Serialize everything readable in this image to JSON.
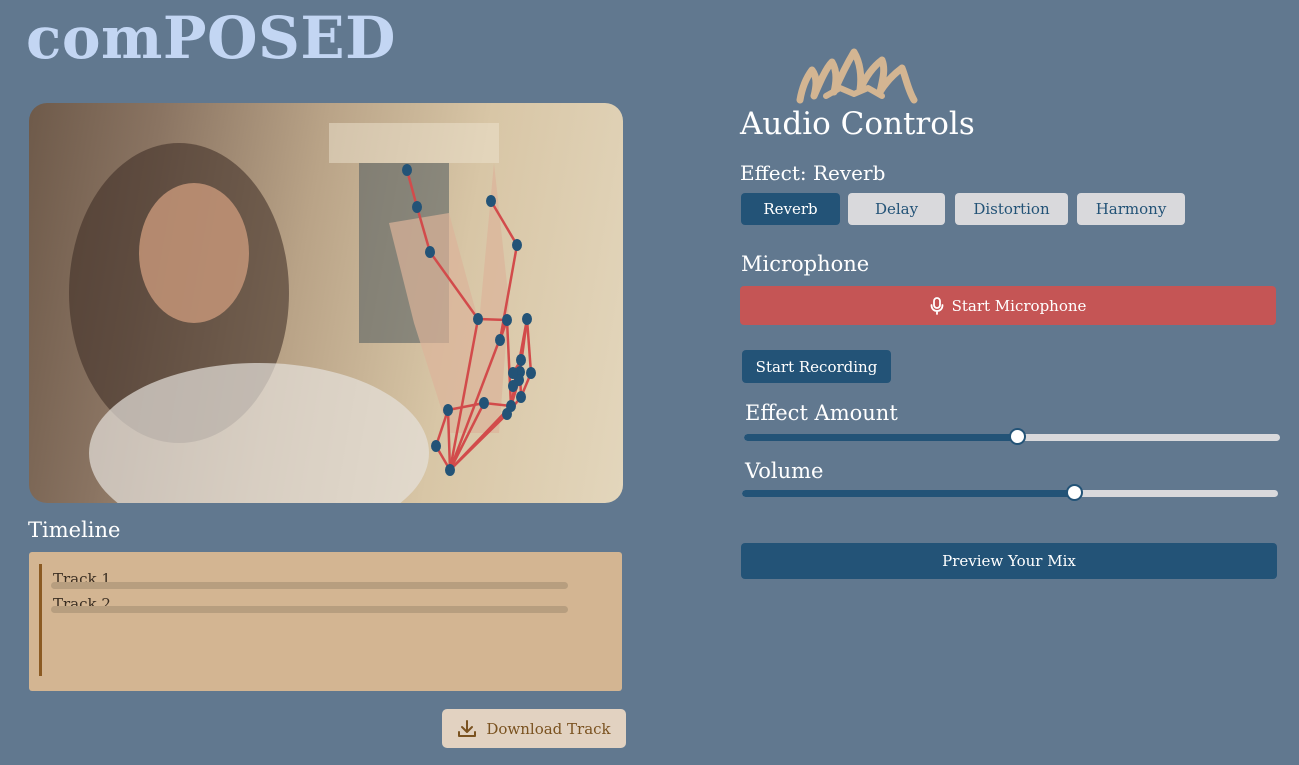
{
  "app": {
    "title": "comPOSED"
  },
  "timeline": {
    "title": "Timeline",
    "tracks": [
      {
        "label": "Track 1"
      },
      {
        "label": "Track 2"
      }
    ],
    "download_label": "Download Track",
    "download_icon": "download-icon"
  },
  "audio_controls": {
    "title": "Audio Controls",
    "effect_label": "Effect: Reverb",
    "effects": [
      {
        "label": "Reverb",
        "active": true
      },
      {
        "label": "Delay",
        "active": false
      },
      {
        "label": "Distortion",
        "active": false
      },
      {
        "label": "Harmony",
        "active": false
      }
    ],
    "microphone": {
      "title": "Microphone",
      "start_label": "Start Microphone",
      "icon": "microphone-icon"
    },
    "recording_label": "Start Recording",
    "effect_amount": {
      "label": "Effect Amount",
      "value": 0.51
    },
    "volume": {
      "label": "Volume",
      "value": 0.62
    },
    "preview_label": "Preview Your Mix"
  },
  "colors": {
    "background": "#61788f",
    "logo": "#c3d6f3",
    "primary": "#235377",
    "mic_button": "#c55555",
    "timeline_bg": "#d3b592",
    "crown": "#d3b592",
    "hand_landmark": "#235377",
    "hand_connection": "#d24b4b"
  }
}
